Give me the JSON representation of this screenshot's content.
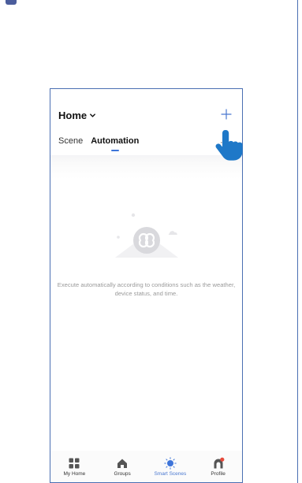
{
  "header": {
    "home_title": "Home",
    "add_icon": "plus-icon"
  },
  "tabs": [
    {
      "label": "Scene",
      "active": false
    },
    {
      "label": "Automation",
      "active": true
    }
  ],
  "empty_state": {
    "illustration_icon": "automation-loop-icon",
    "message": "Execute automatically according to conditions such as the weather, device status, and time."
  },
  "tabbar": [
    {
      "label": "My Home",
      "icon": "grid-icon",
      "active": false
    },
    {
      "label": "Groups",
      "icon": "house-icon",
      "active": false
    },
    {
      "label": "Smart Scenes",
      "icon": "sun-icon",
      "active": true
    },
    {
      "label": "Profile",
      "icon": "profile-icon",
      "active": false
    }
  ],
  "colors": {
    "accent": "#3d74d9",
    "frame_border": "#4a6fb2",
    "pointer_hand": "#1e78c8",
    "profile_dot": "#e64a3b"
  },
  "overlay": {
    "pointer_icon": "pointing-hand-icon"
  }
}
